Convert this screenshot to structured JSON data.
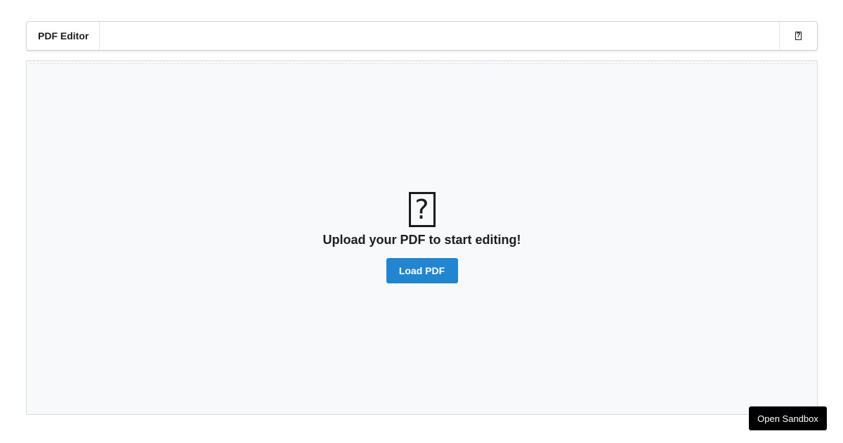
{
  "toolbar": {
    "title": "PDF Editor",
    "help_icon": "help-icon",
    "help_glyph": "?"
  },
  "main": {
    "icon": "document-question-icon",
    "icon_glyph": "?",
    "heading": "Upload your PDF to start editing!",
    "load_button_label": "Load PDF"
  },
  "sandbox": {
    "label": "Open Sandbox"
  },
  "colors": {
    "primary_button": "#2185d0",
    "dropzone_background": "#f8f9fa",
    "sandbox_background": "#000000"
  }
}
